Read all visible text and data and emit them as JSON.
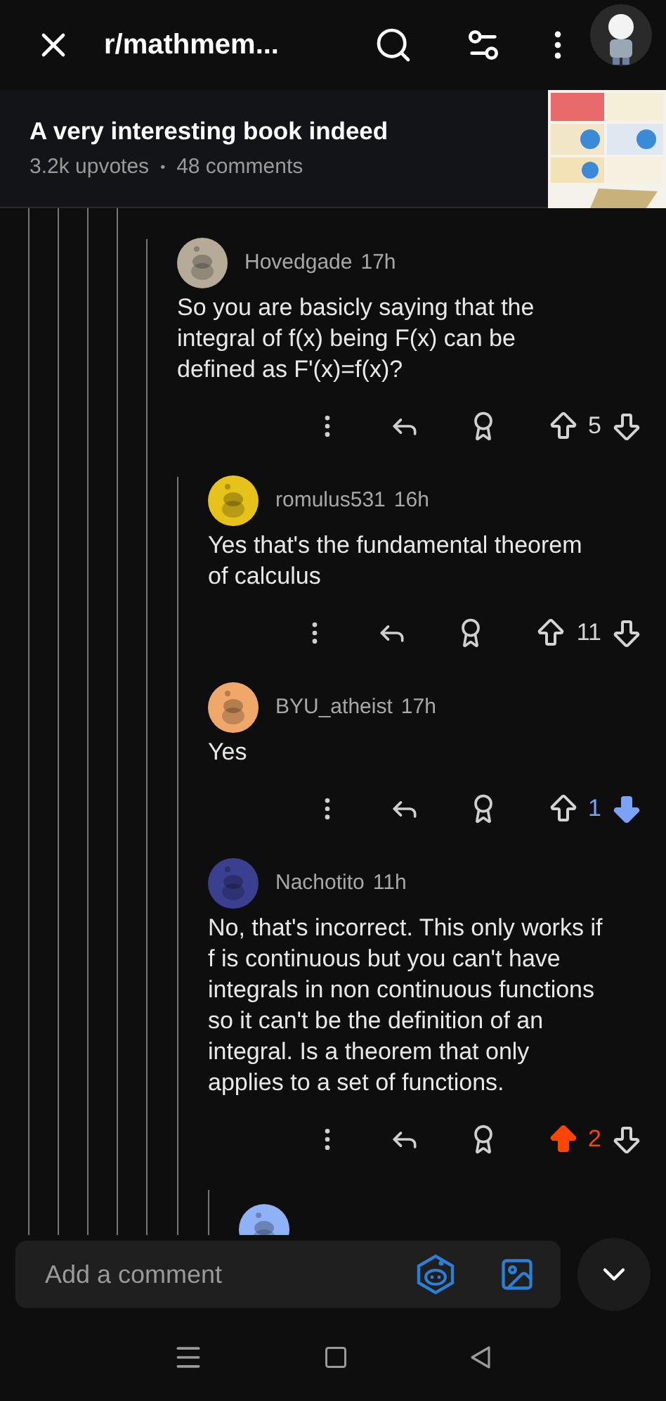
{
  "top_bar": {
    "title": "r/mathmem..."
  },
  "post": {
    "title": "A very interesting book indeed",
    "upvotes": "3.2k upvotes",
    "separator": "•",
    "comments": "48 comments"
  },
  "thread": {
    "author": "Hovedgade",
    "time": "17h",
    "color": "#b5ab98",
    "text": "So you are basicly saying that the integral of f(x) being F(x) can be defined as F'(x)=f(x)?",
    "score": "5",
    "upvoted": false,
    "downvoted": false,
    "children": [
      {
        "author": "romulus531",
        "time": "16h",
        "color": "#e6c21a",
        "text": "Yes that's the fundamental theorem of calculus",
        "score": "11",
        "upvoted": false,
        "downvoted": false
      },
      {
        "author": "BYU_atheist",
        "time": "17h",
        "color": "#f0a76a",
        "text": "Yes",
        "score": "1",
        "upvoted": false,
        "downvoted": true
      },
      {
        "author": "Nachotito",
        "time": "11h",
        "color": "#3b3f8f",
        "text": "No, that's incorrect. This only works if f is continuous but you can't have integrals in non continuous functions so it can't be the definition of an integral. Is a theorem that only applies to a set of functions.",
        "score": "2",
        "upvoted": true,
        "downvoted": false,
        "children": [
          {
            "color": "#8fb1f5"
          }
        ]
      }
    ]
  },
  "composer": {
    "placeholder": "Add a comment"
  }
}
